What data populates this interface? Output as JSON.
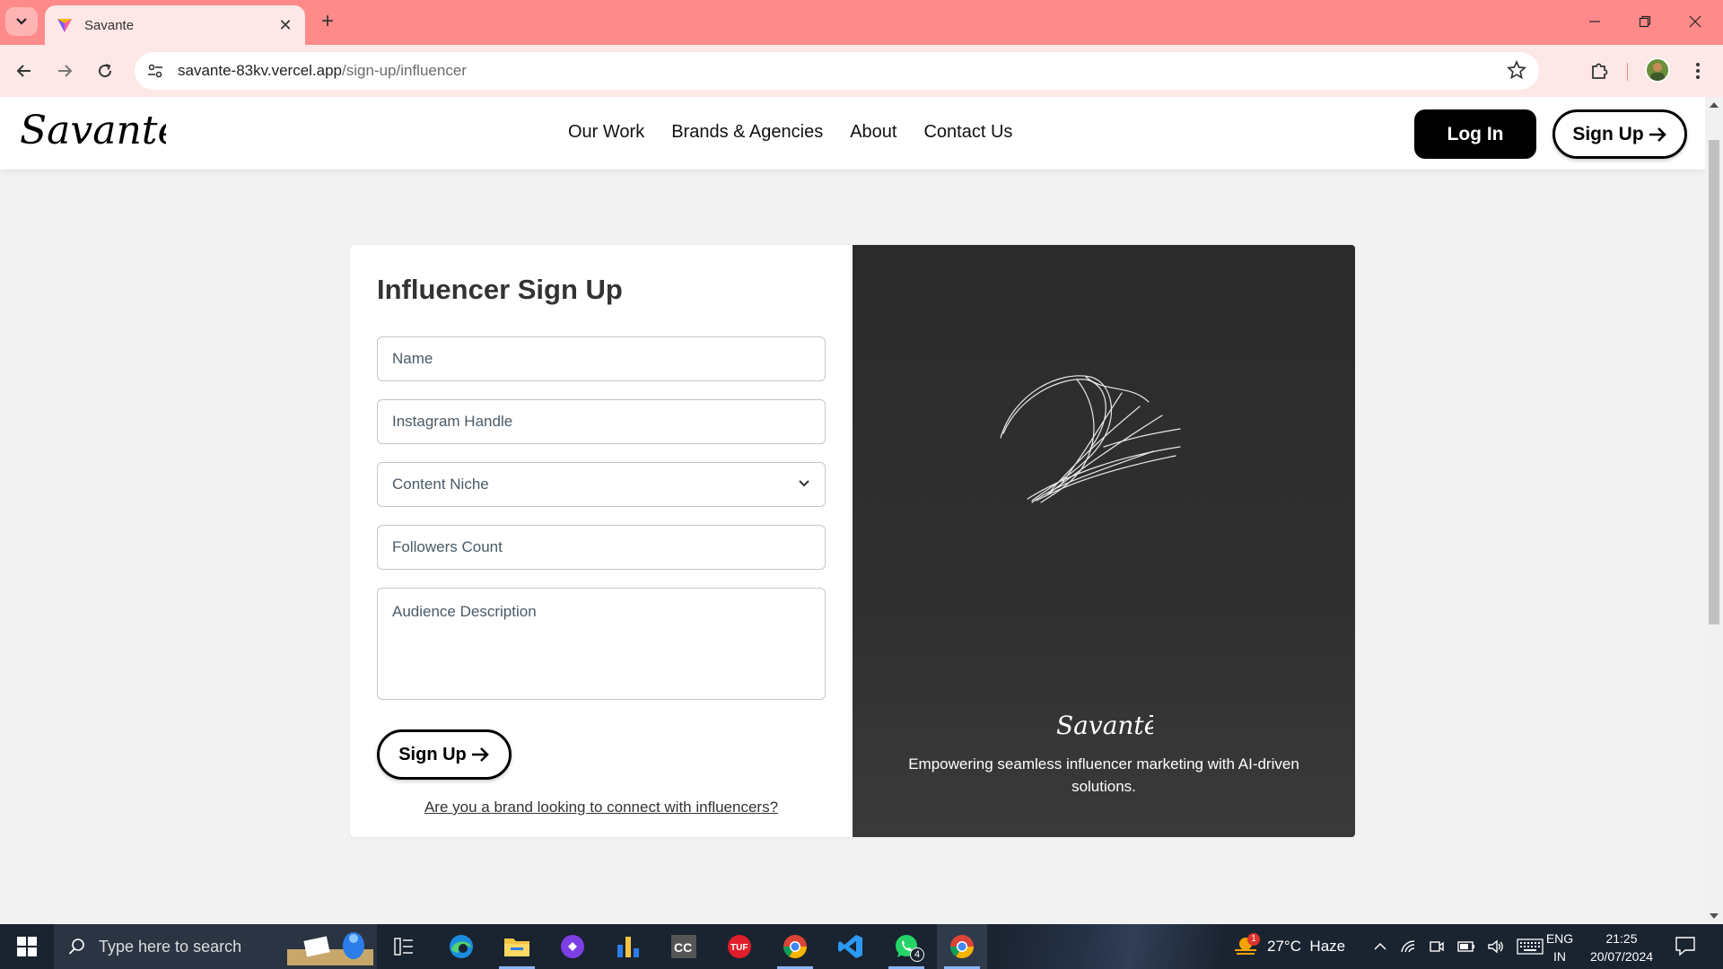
{
  "browser": {
    "tab_title": "Savante",
    "url_domain": "savante-83kv.vercel.app",
    "url_path": "/sign-up/influencer"
  },
  "site": {
    "logo_text": "Savantē",
    "nav": [
      "Our Work",
      "Brands & Agencies",
      "About",
      "Contact Us"
    ],
    "login_label": "Log In",
    "signup_label": "Sign Up"
  },
  "form": {
    "title": "Influencer Sign Up",
    "fields": {
      "name_placeholder": "Name",
      "instagram_placeholder": "Instagram Handle",
      "niche_placeholder": "Content Niche",
      "followers_placeholder": "Followers Count",
      "audience_placeholder": "Audience Description"
    },
    "submit_label": "Sign Up",
    "brand_link": "Are you a brand looking to connect with influencers?"
  },
  "art_panel": {
    "logo_text": "Savantē",
    "tagline": "Empowering seamless influencer marketing with AI-driven solutions."
  },
  "taskbar": {
    "search_placeholder": "Type here to search",
    "weather": "27°C  Haze",
    "lang_line1": "ENG",
    "lang_line2": "IN",
    "time": "21:25",
    "date": "20/07/2024",
    "whatsapp_badge": "4",
    "weather_badge": "1",
    "apps": [
      "task-view",
      "edge",
      "file-explorer",
      "app-purple",
      "app-chart",
      "app-cc",
      "app-tuf",
      "chrome-1",
      "vscode",
      "whatsapp",
      "chrome-2"
    ]
  },
  "colors": {
    "tabbar": "#ff8a8a",
    "toolbar": "#fde7e7",
    "page_bg": "#f2f2f2",
    "art_panel": "#2b2b2b",
    "taskbar": "#1a2330"
  }
}
